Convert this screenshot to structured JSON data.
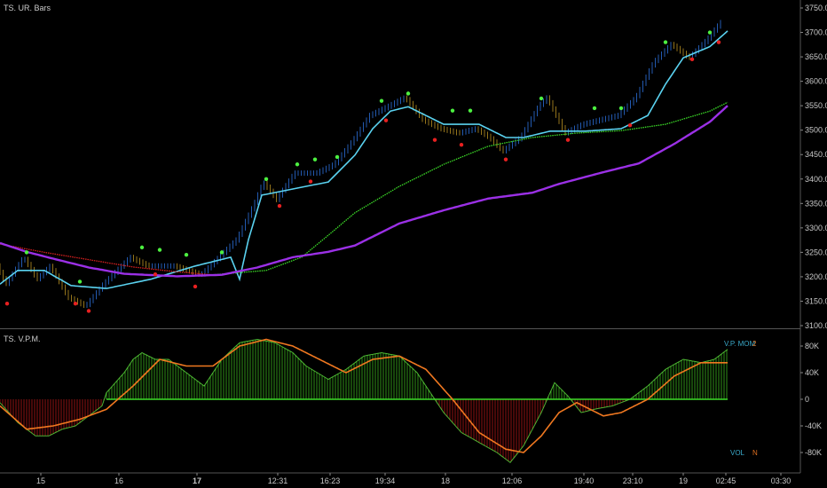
{
  "panels": {
    "price_title": "TS. UR. Bars",
    "osc_title": "TS. V.P.M.",
    "osc_legend_top": [
      "V.P. MOM",
      "2"
    ],
    "osc_legend_bottom": [
      "VOL",
      "N"
    ]
  },
  "colors": {
    "bg": "#000000",
    "cyan": "#5ad2f0",
    "green": "#3cdc28",
    "purple": "#9b30e6",
    "red": "#d82020",
    "orange": "#f07820",
    "bars": "#2a5fb0",
    "hist_pos": "#3fbf1f",
    "hist_neg": "#c01818"
  },
  "chart_data": [
    {
      "type": "line",
      "title": "TS. UR. Bars",
      "ylim": [
        3100,
        3750
      ],
      "yticks": [
        3750,
        3700,
        3650,
        3600,
        3550,
        3500,
        3450,
        3400,
        3350,
        3300,
        3250,
        3200,
        3150,
        3100
      ],
      "ytick_labels": [
        "3750.0",
        "3700.0",
        "3650.0",
        "3600.0",
        "3550.0",
        "3500.0",
        "3450.0",
        "3400.0",
        "3350.0",
        "3300.0",
        "3250.0",
        "3200.0",
        "3150.0",
        "3100.0"
      ],
      "xlim": [
        0,
        90
      ],
      "series": [
        {
          "name": "price",
          "color": "#2a5fb0",
          "points": [
            [
              0,
              3222
            ],
            [
              1,
              3185
            ],
            [
              3,
              3240
            ],
            [
              4.5,
              3195
            ],
            [
              6,
              3222
            ],
            [
              8,
              3158
            ],
            [
              10,
              3140
            ],
            [
              12,
              3185
            ],
            [
              15,
              3240
            ],
            [
              17,
              3222
            ],
            [
              20,
              3222
            ],
            [
              23,
              3204
            ],
            [
              25,
              3240
            ],
            [
              27,
              3276
            ],
            [
              29,
              3350
            ],
            [
              30,
              3394
            ],
            [
              31.5,
              3358
            ],
            [
              33.5,
              3412
            ],
            [
              36,
              3412
            ],
            [
              38,
              3430
            ],
            [
              40,
              3476
            ],
            [
              42,
              3530
            ],
            [
              44,
              3548
            ],
            [
              46,
              3567
            ],
            [
              48,
              3521
            ],
            [
              50,
              3503
            ],
            [
              52,
              3494
            ],
            [
              54,
              3503
            ],
            [
              55.5,
              3485
            ],
            [
              57,
              3457
            ],
            [
              59,
              3485
            ],
            [
              61,
              3548
            ],
            [
              62,
              3567
            ],
            [
              64,
              3494
            ],
            [
              66,
              3512
            ],
            [
              68,
              3521
            ],
            [
              70,
              3530
            ],
            [
              72,
              3567
            ],
            [
              74,
              3639
            ],
            [
              76,
              3676
            ],
            [
              78,
              3648
            ],
            [
              80,
              3685
            ],
            [
              81.5,
              3720
            ]
          ]
        },
        {
          "name": "fast-ma",
          "color": "#5ad2f0",
          "points": [
            [
              0,
              3185
            ],
            [
              2,
              3213
            ],
            [
              5,
              3213
            ],
            [
              8,
              3182
            ],
            [
              12,
              3176
            ],
            [
              17,
              3195
            ],
            [
              22,
              3222
            ],
            [
              26,
              3240
            ],
            [
              27,
              3195
            ],
            [
              28,
              3276
            ],
            [
              29.5,
              3367
            ],
            [
              32,
              3376
            ],
            [
              34.5,
              3385
            ],
            [
              37,
              3394
            ],
            [
              40,
              3449
            ],
            [
              42,
              3503
            ],
            [
              44,
              3539
            ],
            [
              46,
              3548
            ],
            [
              48,
              3530
            ],
            [
              50,
              3512
            ],
            [
              54,
              3512
            ],
            [
              57,
              3485
            ],
            [
              59,
              3485
            ],
            [
              62,
              3498
            ],
            [
              66,
              3498
            ],
            [
              70,
              3503
            ],
            [
              73,
              3530
            ],
            [
              75,
              3594
            ],
            [
              77,
              3648
            ],
            [
              80,
              3671
            ],
            [
              82,
              3703
            ]
          ]
        },
        {
          "name": "slow-ma-red",
          "color": "#d82020",
          "points": [
            [
              0,
              3267
            ],
            [
              5,
              3250
            ],
            [
              10,
              3235
            ],
            [
              15,
              3220
            ],
            [
              20,
              3210
            ],
            [
              24,
              3204
            ]
          ]
        },
        {
          "name": "slow-ma-green",
          "color": "#3cdc28",
          "points": [
            [
              24,
              3204
            ],
            [
              30,
              3213
            ],
            [
              34,
              3240
            ],
            [
              37,
              3285
            ],
            [
              40,
              3331
            ],
            [
              45,
              3385
            ],
            [
              50,
              3430
            ],
            [
              55,
              3467
            ],
            [
              60,
              3485
            ],
            [
              65,
              3494
            ],
            [
              70,
              3499
            ],
            [
              75,
              3512
            ],
            [
              80,
              3539
            ],
            [
              82,
              3557
            ]
          ]
        },
        {
          "name": "long-ma",
          "color": "#9b30e6",
          "points": [
            [
              0,
              3269
            ],
            [
              3,
              3251
            ],
            [
              6,
              3237
            ],
            [
              10,
              3219
            ],
            [
              14,
              3206
            ],
            [
              20,
              3201
            ],
            [
              25,
              3204
            ],
            [
              29,
              3219
            ],
            [
              33,
              3240
            ],
            [
              37,
              3251
            ],
            [
              40,
              3264
            ],
            [
              45,
              3309
            ],
            [
              50,
              3336
            ],
            [
              55,
              3360
            ],
            [
              60,
              3372
            ],
            [
              63,
              3390
            ],
            [
              68,
              3414
            ],
            [
              72,
              3432
            ],
            [
              76,
              3472
            ],
            [
              80,
              3517
            ],
            [
              82,
              3550
            ]
          ]
        }
      ],
      "markers_up": [
        [
          3,
          3250
        ],
        [
          9,
          3190
        ],
        [
          16,
          3260
        ],
        [
          18,
          3255
        ],
        [
          21,
          3245
        ],
        [
          25,
          3250
        ],
        [
          30,
          3400
        ],
        [
          33.5,
          3430
        ],
        [
          35.5,
          3440
        ],
        [
          38,
          3445
        ],
        [
          43,
          3560
        ],
        [
          46,
          3575
        ],
        [
          51,
          3540
        ],
        [
          53,
          3540
        ],
        [
          61,
          3565
        ],
        [
          67,
          3545
        ],
        [
          70,
          3545
        ],
        [
          75,
          3680
        ],
        [
          80,
          3700
        ]
      ],
      "markers_down": [
        [
          0.8,
          3145
        ],
        [
          8.5,
          3145
        ],
        [
          10,
          3130
        ],
        [
          17.5,
          3205
        ],
        [
          22,
          3180
        ],
        [
          31.5,
          3345
        ],
        [
          35,
          3395
        ],
        [
          43.5,
          3520
        ],
        [
          49,
          3480
        ],
        [
          52,
          3470
        ],
        [
          57,
          3440
        ],
        [
          64,
          3480
        ],
        [
          71,
          3510
        ],
        [
          78,
          3645
        ],
        [
          81,
          3680
        ]
      ]
    },
    {
      "type": "bar",
      "title": "TS. V.P.M.",
      "ylim": [
        -100000,
        100000
      ],
      "yticks": [
        80000,
        40000,
        0,
        -40000,
        -80000
      ],
      "ytick_labels": [
        "80K",
        "40K",
        "0",
        "-40K",
        "-80K"
      ],
      "histogram": [
        [
          0,
          -5
        ],
        [
          1,
          -20
        ],
        [
          2,
          -35
        ],
        [
          4,
          -55
        ],
        [
          5.5,
          -55
        ],
        [
          7,
          -45
        ],
        [
          8.5,
          -40
        ],
        [
          10,
          -25
        ],
        [
          11.5,
          -10
        ],
        [
          12,
          10
        ],
        [
          14,
          40
        ],
        [
          15,
          60
        ],
        [
          16,
          70
        ],
        [
          17.5,
          60
        ],
        [
          19,
          60
        ],
        [
          21,
          40
        ],
        [
          23,
          20
        ],
        [
          25,
          60
        ],
        [
          27,
          85
        ],
        [
          29,
          90
        ],
        [
          31,
          85
        ],
        [
          33,
          70
        ],
        [
          34.5,
          50
        ],
        [
          37,
          30
        ],
        [
          39,
          45
        ],
        [
          41,
          65
        ],
        [
          43,
          70
        ],
        [
          45,
          65
        ],
        [
          47,
          40
        ],
        [
          48.5,
          10
        ],
        [
          50,
          -20
        ],
        [
          52,
          -50
        ],
        [
          54,
          -65
        ],
        [
          56,
          -80
        ],
        [
          57.5,
          -95
        ],
        [
          59,
          -70
        ],
        [
          61,
          -20
        ],
        [
          62.5,
          25
        ],
        [
          64,
          5
        ],
        [
          65.5,
          -20
        ],
        [
          67,
          -15
        ],
        [
          69,
          -10
        ],
        [
          71,
          0
        ],
        [
          73,
          20
        ],
        [
          75,
          45
        ],
        [
          77,
          60
        ],
        [
          79,
          55
        ],
        [
          80.5,
          60
        ],
        [
          82,
          75
        ]
      ],
      "signal": [
        [
          0,
          -10
        ],
        [
          3,
          -45
        ],
        [
          6,
          -40
        ],
        [
          9,
          -30
        ],
        [
          12,
          -15
        ],
        [
          15,
          20
        ],
        [
          18,
          60
        ],
        [
          21,
          50
        ],
        [
          24,
          50
        ],
        [
          27,
          80
        ],
        [
          30,
          90
        ],
        [
          33,
          80
        ],
        [
          36,
          60
        ],
        [
          39,
          40
        ],
        [
          42,
          60
        ],
        [
          45,
          65
        ],
        [
          48,
          45
        ],
        [
          51,
          0
        ],
        [
          54,
          -50
        ],
        [
          57,
          -75
        ],
        [
          59,
          -80
        ],
        [
          61,
          -55
        ],
        [
          63,
          -20
        ],
        [
          65,
          -5
        ],
        [
          68,
          -25
        ],
        [
          70,
          -20
        ],
        [
          73,
          0
        ],
        [
          76,
          35
        ],
        [
          79,
          55
        ],
        [
          82,
          55
        ]
      ]
    }
  ],
  "x_axis": {
    "ticks": [
      [
        4.6,
        "15"
      ],
      [
        13.4,
        "16"
      ],
      [
        22.2,
        "17"
      ],
      [
        31.3,
        "12:31"
      ],
      [
        37.2,
        "16:23"
      ],
      [
        43.4,
        "19:34"
      ],
      [
        50.2,
        "18"
      ],
      [
        57.7,
        "12:06"
      ],
      [
        65.8,
        "19:40"
      ],
      [
        71.3,
        "23:10"
      ],
      [
        77,
        "19"
      ],
      [
        81.8,
        "02:45"
      ],
      [
        88,
        "03:30"
      ]
    ],
    "bold": [
      "17"
    ]
  }
}
